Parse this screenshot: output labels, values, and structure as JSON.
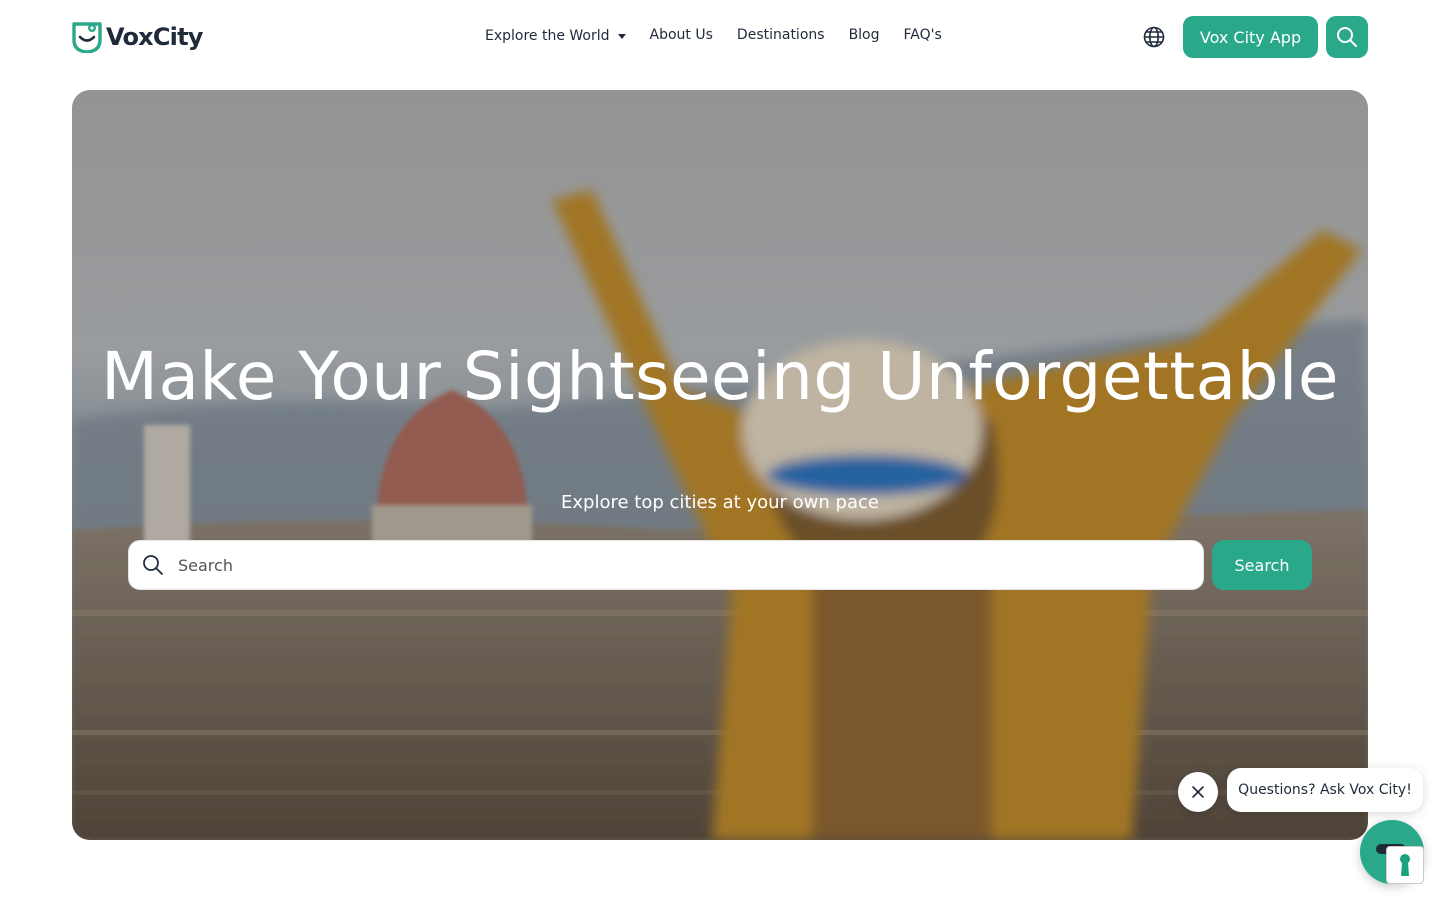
{
  "brand": {
    "name": "VoxCity",
    "accent": "#2aa98a"
  },
  "nav": {
    "explore_label": "Explore the World",
    "about_label": "About Us",
    "destinations_label": "Destinations",
    "blog_label": "Blog",
    "faq_label": "FAQ's"
  },
  "header": {
    "language_icon": "globe-icon",
    "app_button_label": "Vox City App",
    "search_icon": "search-icon"
  },
  "hero": {
    "title": "Make Your Sightseeing Unforgettable",
    "subtitle": "Explore top cities at your own pace",
    "search_placeholder": "Search",
    "search_button_label": "Search"
  },
  "chat": {
    "prompt": "Questions? Ask Vox City!",
    "close_icon": "close-icon",
    "launcher_icon": "chat-icon"
  }
}
